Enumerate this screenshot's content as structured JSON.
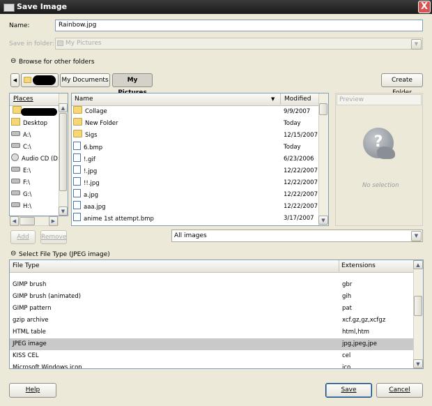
{
  "window": {
    "title": "Save Image",
    "close_label": "X"
  },
  "name_label": "Name:",
  "name_value": "Rainbow.jpg",
  "save_in_label": "Save in folder:",
  "save_in_value": "My Pictures",
  "browse_label": "Browse for other folders",
  "path_buttons": [
    "My Documents",
    "My Pictures"
  ],
  "create_folder_label": "Create Folder",
  "places": {
    "header": "Places",
    "items": [
      "Desktop",
      "A:\\",
      "C:\\",
      "Audio CD (D:",
      "E:\\",
      "F:\\",
      "G:\\",
      "H:\\"
    ]
  },
  "files": {
    "col_name": "Name",
    "col_modified": "Modified",
    "rows": [
      {
        "name": "Collage",
        "modified": "9/9/2007",
        "type": "folder"
      },
      {
        "name": "New Folder",
        "modified": "Today",
        "type": "folder"
      },
      {
        "name": "Sigs",
        "modified": "12/15/2007",
        "type": "folder"
      },
      {
        "name": "6.bmp",
        "modified": "Today",
        "type": "file"
      },
      {
        "name": "!.gif",
        "modified": "6/23/2006",
        "type": "file"
      },
      {
        "name": "!.jpg",
        "modified": "12/22/2007",
        "type": "file"
      },
      {
        "name": "!!.jpg",
        "modified": "12/22/2007",
        "type": "file"
      },
      {
        "name": "a.jpg",
        "modified": "12/22/2007",
        "type": "file"
      },
      {
        "name": "aaa.jpg",
        "modified": "12/22/2007",
        "type": "file"
      },
      {
        "name": "anime 1st attempt.bmp",
        "modified": "3/17/2007",
        "type": "file"
      }
    ]
  },
  "preview": {
    "header": "Preview",
    "empty_text": "No selection"
  },
  "add_label": "Add",
  "remove_label": "Remove",
  "filter_value": "All images",
  "select_type_label": "Select File Type (JPEG image)",
  "types": {
    "col_type": "File Type",
    "col_ext": "Extensions",
    "rows": [
      {
        "type": "GIMP brush",
        "ext": "gbr"
      },
      {
        "type": "GIMP brush (animated)",
        "ext": "gih"
      },
      {
        "type": "GIMP pattern",
        "ext": "pat"
      },
      {
        "type": "gzip archive",
        "ext": "xcf.gz,gz,xcfgz"
      },
      {
        "type": "HTML table",
        "ext": "html,htm"
      },
      {
        "type": "JPEG image",
        "ext": "jpg,jpeg,jpe",
        "selected": true
      },
      {
        "type": "KISS CEL",
        "ext": "cel"
      },
      {
        "type": "Microsoft Windows icon",
        "ext": "ico"
      }
    ]
  },
  "help_label": "Help",
  "save_label": "Save",
  "cancel_label": "Cancel",
  "icons": {
    "collapse": "⊖",
    "back": "◀",
    "sort_down": "▼",
    "scroll_up": "▲",
    "scroll_down": "▼",
    "scroll_left": "◀",
    "scroll_right": "▶",
    "combo_arrow": "▼",
    "preview_question": "?"
  }
}
